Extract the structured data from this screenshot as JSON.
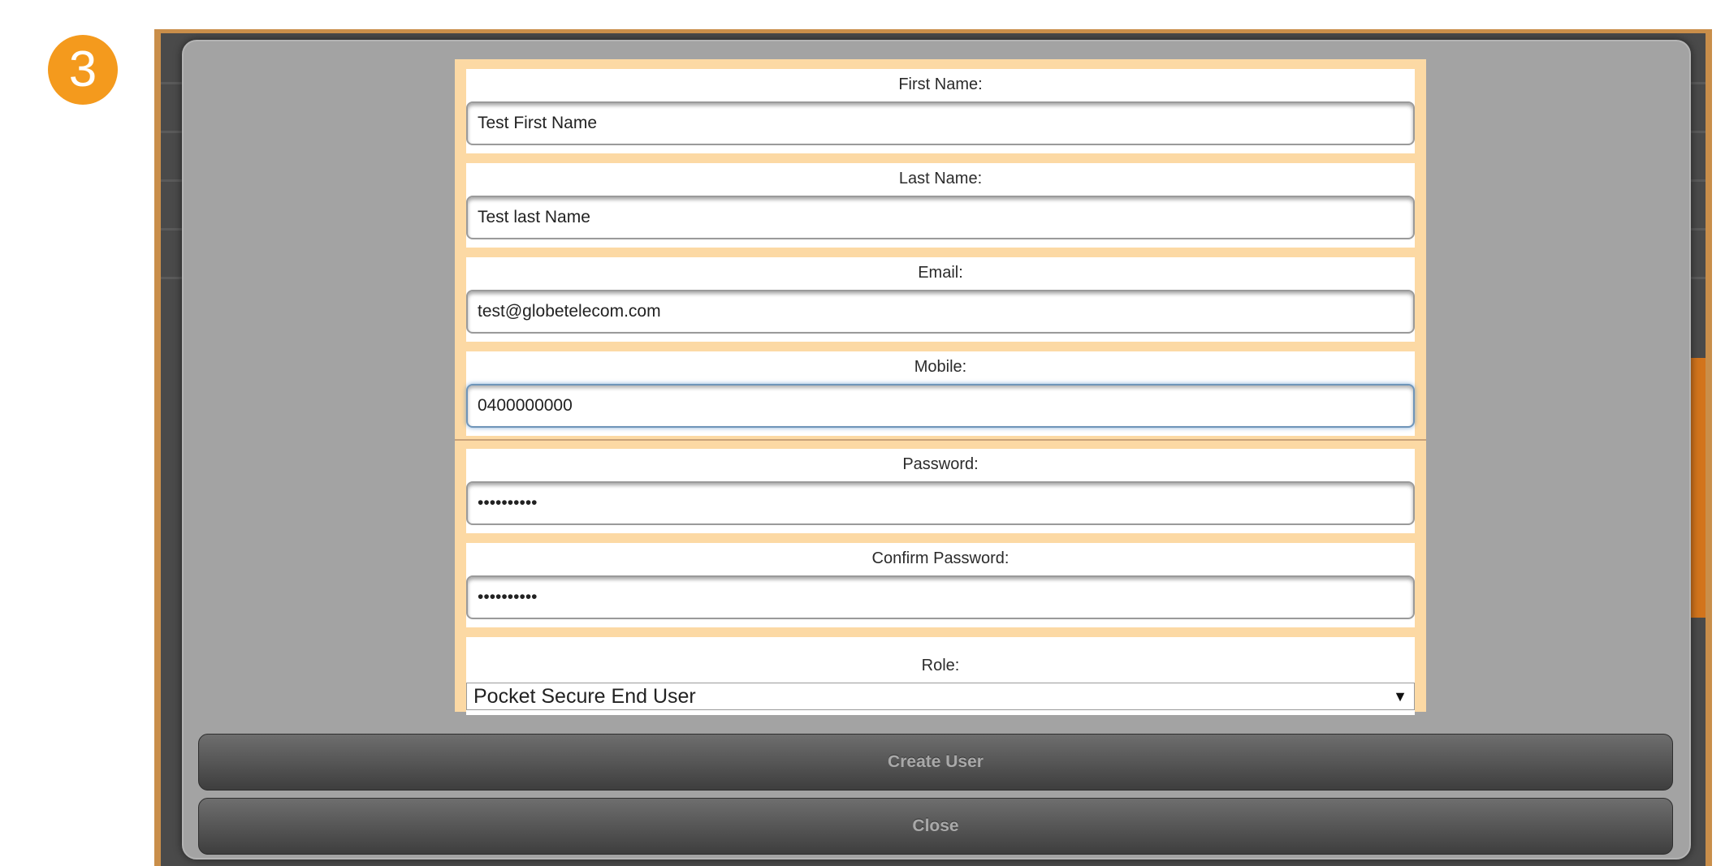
{
  "step_badge": "3",
  "form": {
    "fields": [
      {
        "label": "First Name:",
        "value": "Test First Name"
      },
      {
        "label": "Last Name:",
        "value": "Test last Name"
      },
      {
        "label": "Email:",
        "value": "test@globetelecom.com"
      },
      {
        "label": "Mobile:",
        "value": "0400000000"
      },
      {
        "label": "Password:",
        "value": "••••••••••"
      },
      {
        "label": "Confirm Password:",
        "value": "••••••••••"
      }
    ],
    "role": {
      "label": "Role:",
      "selected": "Pocket Secure End User",
      "arrow": "▼"
    }
  },
  "buttons": {
    "create_user": "Create User",
    "close": "Close"
  },
  "colors": {
    "badge": "#f49a1d",
    "form_card": "#fcd9a4",
    "dialog": "#a3a3a3"
  }
}
